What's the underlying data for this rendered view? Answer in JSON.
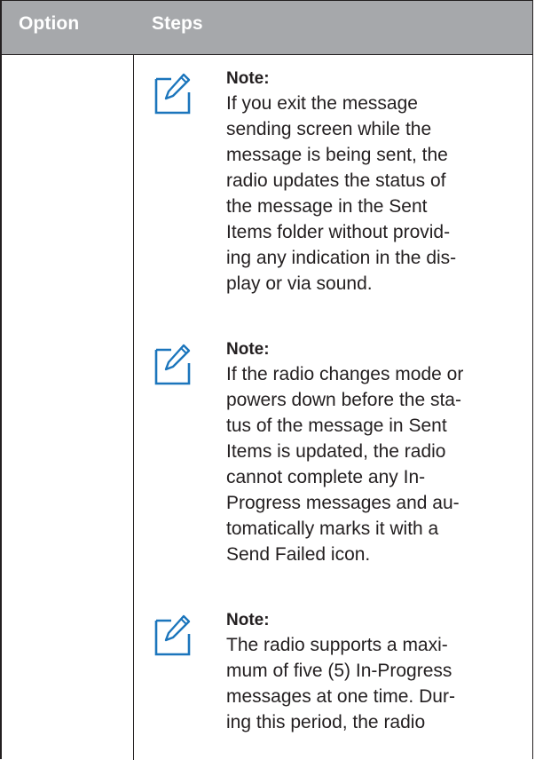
{
  "table": {
    "headers": {
      "option": "Option",
      "steps": "Steps"
    }
  },
  "notes": [
    {
      "icon": "note-pencil-icon",
      "title": "Note:",
      "lines": [
        "If you exit the message",
        "sending screen while the",
        "message is being sent, the",
        "radio updates the status of",
        "the message in the Sent",
        "Items folder without provid-",
        "ing any indication in the dis-",
        "play or via sound."
      ]
    },
    {
      "icon": "note-pencil-icon",
      "title": "Note:",
      "lines": [
        "If the radio changes mode or",
        "powers down before the sta-",
        "tus of the message in Sent",
        "Items is updated, the radio",
        "cannot complete any In-",
        "Progress messages and au-",
        "tomatically marks it with a",
        "Send Failed icon."
      ]
    },
    {
      "icon": "note-pencil-icon",
      "title": "Note:",
      "lines": [
        "The radio supports a maxi-",
        "mum of five (5) In-Progress",
        "messages at one time. Dur-",
        "ing this period, the radio"
      ]
    }
  ],
  "colors": {
    "header_background": "#a6a8ab",
    "header_text": "#ffffff",
    "icon_blue": "#1b75bc",
    "body_text": "#231f20"
  }
}
